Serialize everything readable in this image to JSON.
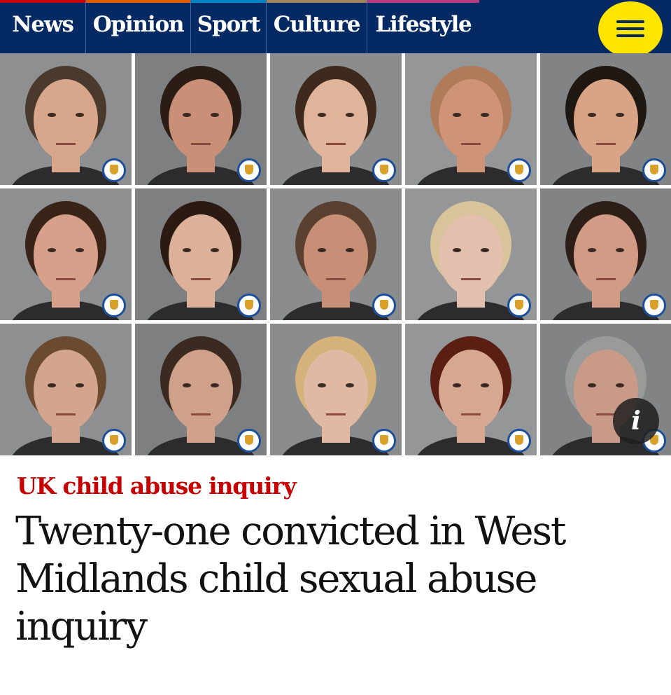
{
  "nav": {
    "items": [
      {
        "label": "News",
        "color": "#c70000"
      },
      {
        "label": "Opinion",
        "color": "#e05e00"
      },
      {
        "label": "Sport",
        "color": "#0084c6"
      },
      {
        "label": "Culture",
        "color": "#a1845c"
      },
      {
        "label": "Lifestyle",
        "color": "#bb3b80"
      }
    ],
    "menu_icon": "hamburger-icon",
    "menu_color": "#ffe500",
    "background": "#052962"
  },
  "photos": {
    "count": 15,
    "badge_icon": "police-crest-icon",
    "info_icon_glyph": "i"
  },
  "article": {
    "kicker": "UK child abuse inquiry",
    "headline": "Twenty-one convicted in West Midlands child sexual abuse inquiry",
    "kicker_color": "#c70000"
  }
}
